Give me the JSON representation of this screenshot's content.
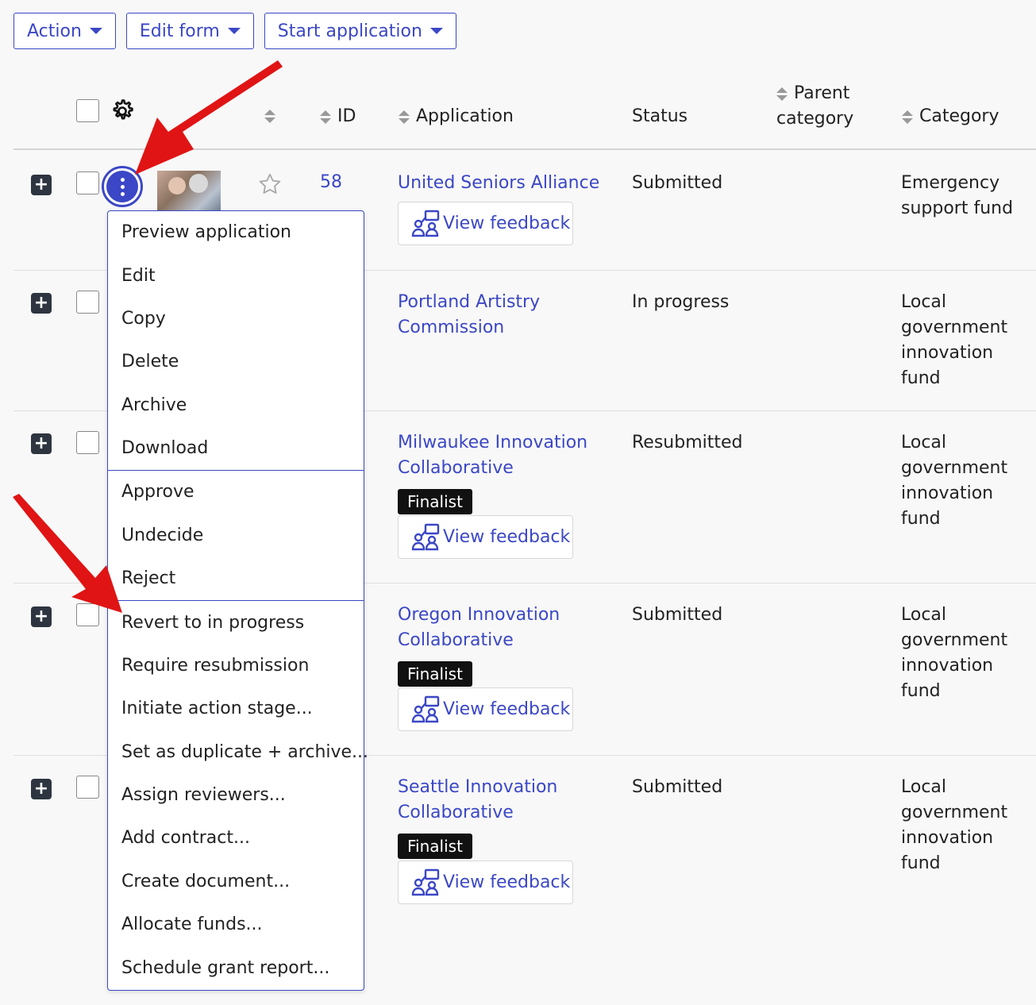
{
  "toolbar": {
    "action": "Action",
    "edit_form": "Edit form",
    "start_application": "Start application"
  },
  "columns": {
    "id": "ID",
    "application": "Application",
    "status": "Status",
    "parent_category_line1": "Parent",
    "parent_category_line2": "category",
    "category": "Category"
  },
  "rows": [
    {
      "id": "58",
      "app_line1": "United Seniors Alliance",
      "app_line2": "",
      "status": "Submitted",
      "cat1": "Emergency",
      "cat2": "support fund",
      "cat3": "",
      "cat4": "",
      "badge": "",
      "feedback": "View feedback"
    },
    {
      "app_line1": "Portland Artistry",
      "app_line2": "Commission",
      "status": "In progress",
      "cat1": "Local",
      "cat2": "government",
      "cat3": "innovation",
      "cat4": "fund"
    },
    {
      "app_line1": "Milwaukee Innovation",
      "app_line2": "Collaborative",
      "status": "Resubmitted",
      "cat1": "Local",
      "cat2": "government",
      "cat3": "innovation",
      "cat4": "fund",
      "badge": "Finalist",
      "feedback": "View feedback"
    },
    {
      "app_line1": "Oregon Innovation",
      "app_line2": "Collaborative",
      "status": "Submitted",
      "cat1": "Local",
      "cat2": "government",
      "cat3": "innovation",
      "cat4": "fund",
      "badge": "Finalist",
      "feedback": "View feedback"
    },
    {
      "app_line1": "Seattle Innovation",
      "app_line2": "Collaborative",
      "status": "Submitted",
      "cat1": "Local",
      "cat2": "government",
      "cat3": "innovation",
      "cat4": "fund",
      "badge": "Finalist",
      "feedback": "View feedback"
    }
  ],
  "menu": {
    "group1": [
      "Preview application",
      "Edit",
      "Copy",
      "Delete",
      "Archive",
      "Download"
    ],
    "group2": [
      "Approve",
      "Undecide",
      "Reject"
    ],
    "group3": [
      "Revert to in progress",
      "Require resubmission",
      "Initiate action stage...",
      "Set as duplicate + archive...",
      "Assign reviewers...",
      "Add contract...",
      "Create document...",
      "Allocate funds...",
      "Schedule grant report..."
    ]
  },
  "colors": {
    "accent": "#3b47c6",
    "arrow": "#e01414",
    "badge_bg": "#111111"
  },
  "icons": {
    "settings": "gear-icon",
    "favorite": "star-icon",
    "row_actions": "kebab-icon",
    "expand": "plus-icon",
    "feedback": "reviewers-icon"
  }
}
